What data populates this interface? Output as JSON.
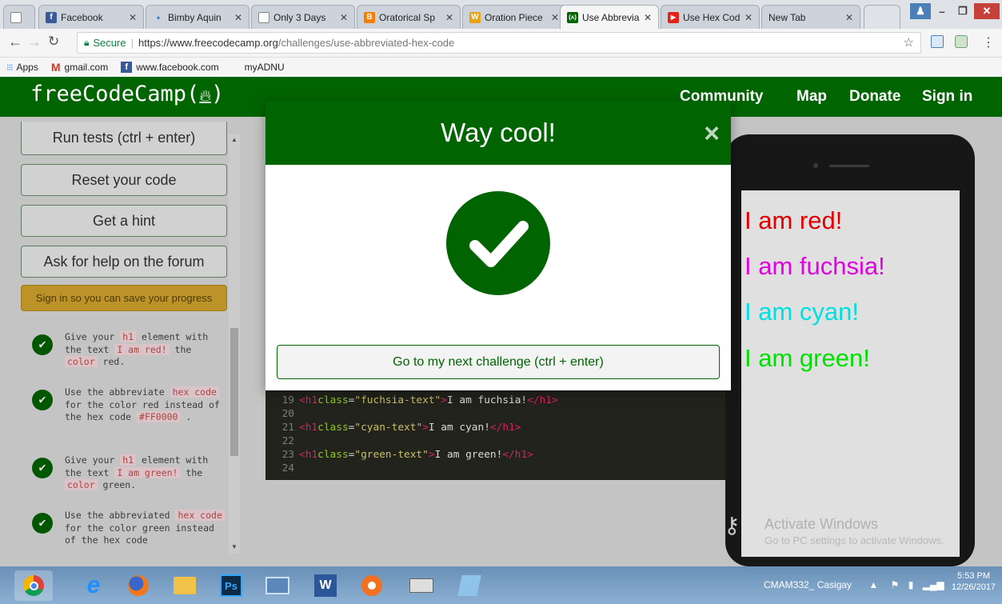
{
  "browser": {
    "tabs": [
      {
        "label": "",
        "icon": "blank-page-icon"
      },
      {
        "label": "Facebook",
        "icon": "facebook-icon"
      },
      {
        "label": "Bimby Aquin",
        "icon": "loading-icon"
      },
      {
        "label": "Only 3 Days",
        "icon": "blank-page-icon"
      },
      {
        "label": "Oratorical Sp",
        "icon": "blogger-icon"
      },
      {
        "label": "Oration Piece",
        "icon": "wattpad-icon"
      },
      {
        "label": "Use Abbrevia",
        "icon": "freecodecamp-icon"
      },
      {
        "label": "Use Hex Cod",
        "icon": "youtube-icon"
      },
      {
        "label": "New Tab",
        "icon": "none"
      }
    ],
    "secure_label": "Secure",
    "url_host": "https://www.freecodecamp.org",
    "url_path": "/challenges/use-abbreviated-hex-code",
    "bookmarks": [
      "Apps",
      "gmail.com",
      "www.facebook.com",
      "myADNU"
    ]
  },
  "fcc_nav": {
    "logo_text": "freeCodeCamp(",
    "logo_end": ")",
    "links": [
      "Community",
      "Map",
      "Donate",
      "Sign in"
    ]
  },
  "sidebar": {
    "run_tests": "Run tests (ctrl + enter)",
    "reset": "Reset your code",
    "hint": "Get a hint",
    "forum": "Ask for help on the forum",
    "signin_save": "Sign in so you can save your progress"
  },
  "tests": [
    {
      "parts": [
        "Give your ",
        "h1",
        " element with the text ",
        "I am red!",
        " the ",
        "color",
        " red."
      ]
    },
    {
      "parts": [
        "Use the abbreviate ",
        "hex code",
        " for the color red instead of the hex code ",
        "#FF0000",
        " ."
      ]
    },
    {
      "parts": [
        "Give your ",
        "h1",
        " element with the text ",
        "I am green!",
        " the ",
        "color",
        " green."
      ]
    },
    {
      "parts": [
        "Use the abbreviated ",
        "hex code",
        " for the color green instead of the hex code"
      ]
    }
  ],
  "editor": {
    "lines": [
      {
        "n": "19",
        "cls": "fuchsia-text",
        "text": "I am fuchsia!"
      },
      {
        "n": "20"
      },
      {
        "n": "21",
        "cls": "cyan-text",
        "text": "I am cyan!"
      },
      {
        "n": "22"
      },
      {
        "n": "23",
        "cls": "green-text",
        "text": "I am green!"
      },
      {
        "n": "24"
      }
    ]
  },
  "preview": [
    {
      "text": "I am red!",
      "color": "#ff0000"
    },
    {
      "text": "I am fuchsia!",
      "color": "#ff00ff"
    },
    {
      "text": "I am cyan!",
      "color": "#00ffff"
    },
    {
      "text": "I am green!",
      "color": "#00ff00"
    }
  ],
  "modal": {
    "title": "Way cool!",
    "close": "×",
    "next_button": "Go to my next challenge (ctrl + enter)"
  },
  "watermark": {
    "title": "Activate Windows",
    "subtitle": "Go to PC settings to activate Windows."
  },
  "taskbar": {
    "user": "CMAM332_ Casigay",
    "time": "5:53 PM",
    "date": "12/26/2017"
  },
  "colors": {
    "fcc_green": "#006400",
    "sign_in_yellow": "#d6a82e"
  }
}
